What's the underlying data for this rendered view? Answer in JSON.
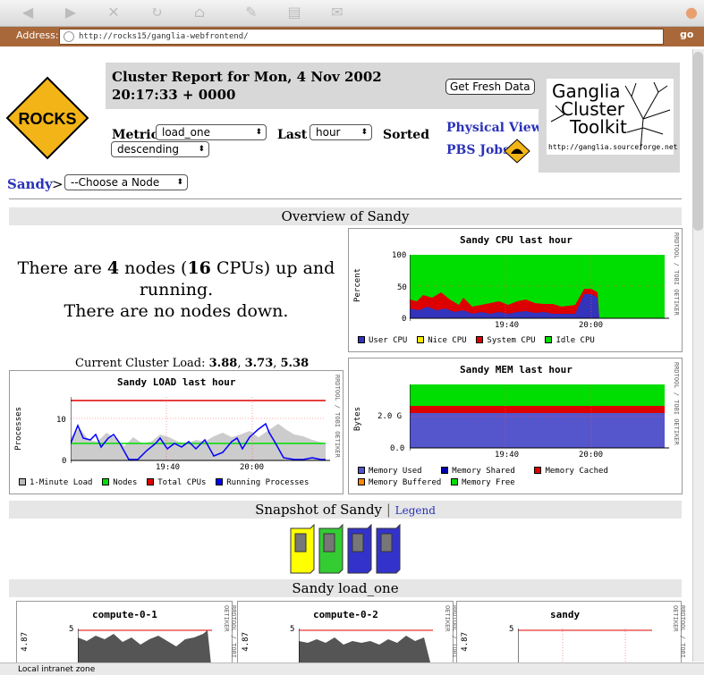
{
  "browser": {
    "address_label": "Address:",
    "url": "http://rocks15/ganglia-webfrontend/",
    "go_label": "go",
    "status_text": "Local intranet zone"
  },
  "header": {
    "logo_text": "ROCKS",
    "title": "Cluster Report for Mon, 4 Nov 2002 20:17:33 + 0000",
    "fresh_button": "Get Fresh Data",
    "metric_label": "Metric",
    "metric_value": "load_one",
    "last_label": "Last",
    "last_value": "hour",
    "sorted_label": "Sorted",
    "sorted_value": "descending",
    "physical_view": "Physical View",
    "pbs_jobs": "PBS Jobs",
    "ganglia_line1": "Ganglia",
    "ganglia_line2": "Cluster",
    "ganglia_line3": "Toolkit",
    "ganglia_url": "http://ganglia.sourceforge.net"
  },
  "breadcrumb": {
    "cluster": "Sandy",
    "separator": ">",
    "node_select": "--Choose a Node"
  },
  "overview": {
    "title": "Overview of Sandy",
    "line1_a": "There are ",
    "nodes": "4",
    "line1_b": " nodes (",
    "cpus": "16",
    "line1_c": " CPUs) up and running.",
    "line2": "There are no nodes down.",
    "load_label": "Current Cluster Load: ",
    "load1": "3.88",
    "load2": "3.73",
    "load3": "5.38",
    "sep": ", "
  },
  "graphs": {
    "side_text": "RRDTOOL / TOBI OETIKER",
    "cpu": {
      "title": "Sandy CPU last hour",
      "ylabel": "Percent",
      "yticks": [
        "100",
        "50",
        "0"
      ],
      "xticks": [
        "19:40",
        "20:00"
      ],
      "legend": [
        "User CPU",
        "Nice CPU",
        "System CPU",
        "Idle CPU"
      ],
      "colors": [
        "#3333bb",
        "#ffea00",
        "#dd0000",
        "#00dd00"
      ]
    },
    "mem": {
      "title": "Sandy MEM last hour",
      "ylabel": "Bytes",
      "yticks": [
        "2.0 G",
        "0.0"
      ],
      "xticks": [
        "19:40",
        "20:00"
      ],
      "legend": [
        "Memory Used",
        "Memory Shared",
        "Memory Cached",
        "Memory Buffered",
        "Memory Free"
      ],
      "colors": [
        "#5555cc",
        "#0000aa",
        "#dd0000",
        "#ff8800",
        "#00dd00"
      ]
    },
    "load": {
      "title": "Sandy LOAD last hour",
      "ylabel": "Processes",
      "yticks": [
        "10",
        "0"
      ],
      "xticks": [
        "19:40",
        "20:00"
      ],
      "legend": [
        "1-Minute Load",
        "Nodes",
        "Total CPUs",
        "Running Processes"
      ],
      "colors": [
        "#bbbbbb",
        "#00dd00",
        "#dd0000",
        "#0000ff"
      ]
    }
  },
  "snapshot": {
    "title": "Snapshot of Sandy",
    "divider": "|",
    "legend_link": "Legend",
    "node_colors": [
      "#ffff00",
      "#33cc33",
      "#3333cc",
      "#3333cc"
    ]
  },
  "load_one": {
    "title": "Sandy load_one",
    "nodes": [
      {
        "name": "compute-0-1",
        "ylabel": "4.87",
        "ytick": "5"
      },
      {
        "name": "compute-0-2",
        "ylabel": "4.87",
        "ytick": "5"
      },
      {
        "name": "sandy",
        "ylabel": "4.87",
        "ytick": "5"
      }
    ]
  }
}
